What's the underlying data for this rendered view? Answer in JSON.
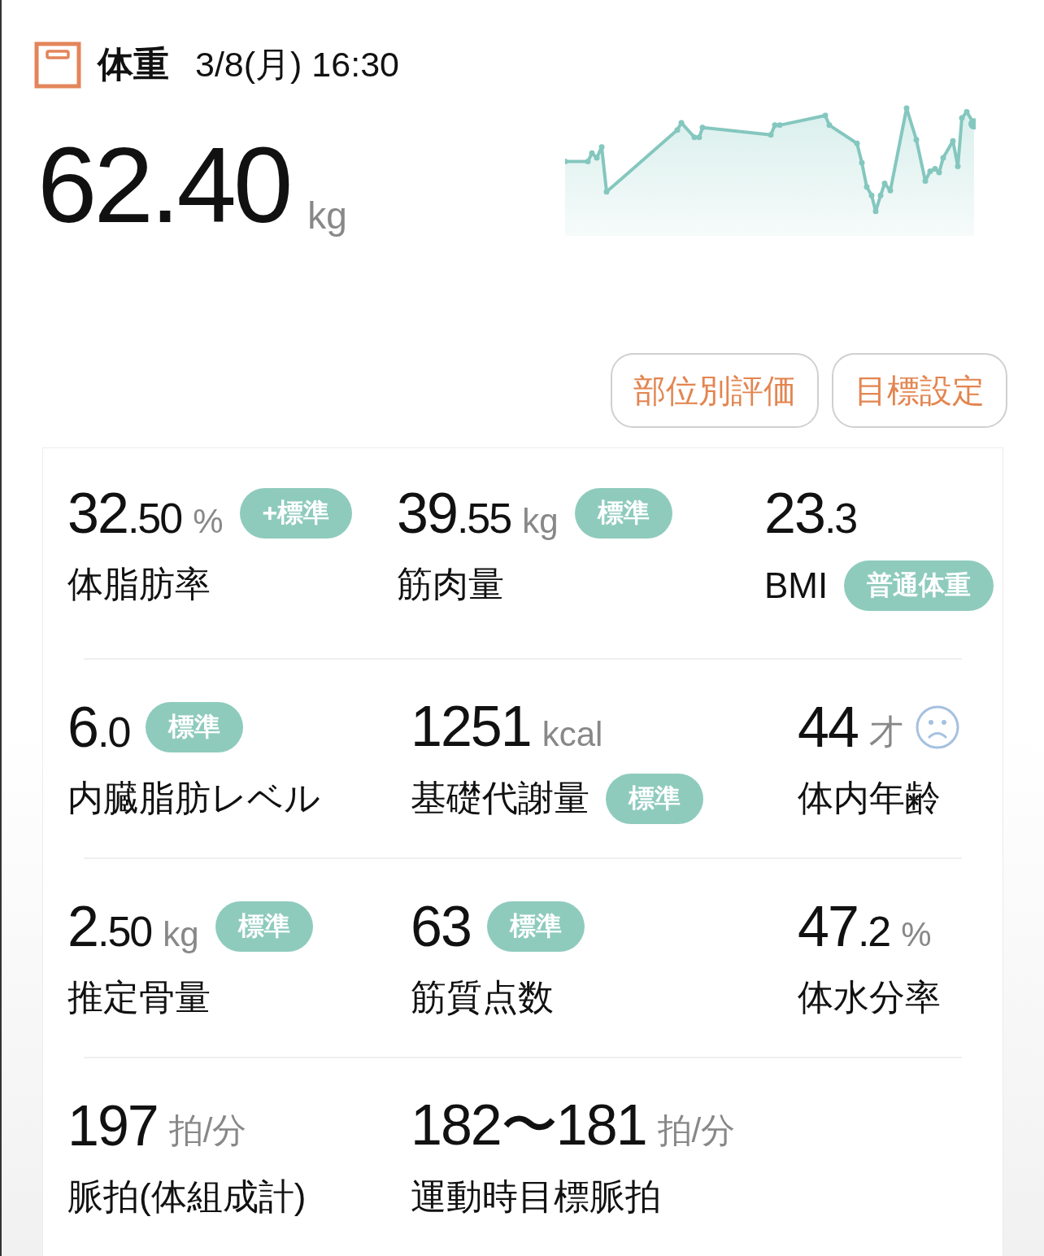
{
  "header": {
    "title": "体重",
    "date": "3/8(月) 16:30",
    "value": "62.40",
    "unit": "kg"
  },
  "buttons": [
    "部位別評価",
    "目標設定"
  ],
  "metric_rows": [
    [
      {
        "kind": "value_badge",
        "value": "32.50",
        "unit": "%",
        "label": "体脂肪率",
        "badge": "+標準"
      },
      {
        "kind": "value_badge",
        "value": "39.55",
        "unit": "kg",
        "label": "筋肉量",
        "badge": "標準"
      },
      {
        "kind": "label_badge",
        "value": "23.3",
        "label": "BMI",
        "badge": "普通体重"
      }
    ],
    [
      {
        "kind": "value_badge",
        "value": "6.0",
        "label": "内臓脂肪レベル",
        "badge": "標準"
      },
      {
        "kind": "label_badge",
        "value": "1251",
        "unit": "kcal",
        "label": "基礎代謝量",
        "badge": "標準"
      },
      {
        "kind": "sad_face",
        "value": "44",
        "unit": "才",
        "label": "体内年齢"
      }
    ],
    [
      {
        "kind": "value_badge",
        "value": "2.50",
        "unit": "kg",
        "label": "推定骨量",
        "badge": "標準"
      },
      {
        "kind": "value_badge",
        "value": "63",
        "label": "筋質点数",
        "badge": "標準"
      },
      {
        "kind": "plain",
        "value": "47.2",
        "unit": "%",
        "label": "体水分率"
      }
    ],
    [
      {
        "kind": "plain",
        "value": "197",
        "unit": "拍/分",
        "label": "脈拍(体組成計)"
      },
      {
        "kind": "plain",
        "value": "182〜181",
        "unit": "拍/分",
        "label": "運動時目標脈拍"
      }
    ]
  ]
}
